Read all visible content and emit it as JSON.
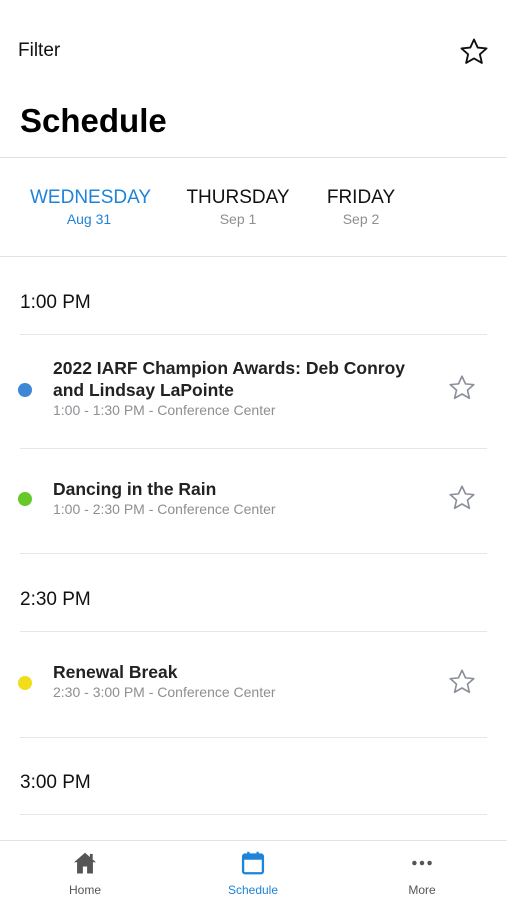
{
  "header": {
    "filter_label": "Filter",
    "favorites_icon": "star-outline-icon",
    "title": "Schedule"
  },
  "days": [
    {
      "name": "WEDNESDAY",
      "date": "Aug 31",
      "active": true
    },
    {
      "name": "THURSDAY",
      "date": "Sep 1",
      "active": false
    },
    {
      "name": "FRIDAY",
      "date": "Sep 2",
      "active": false
    }
  ],
  "schedule": {
    "groups": [
      {
        "time": "1:00 PM",
        "sessions": [
          {
            "title": "2022 IARF Champion Awards: Deb Conroy and Lindsay LaPointe",
            "meta": "1:00 - 1:30 PM - Conference Center",
            "color": "#3d87d6"
          },
          {
            "title": "Dancing in the Rain",
            "meta": "1:00 - 2:30 PM - Conference Center",
            "color": "#66c92a"
          }
        ]
      },
      {
        "time": "2:30 PM",
        "sessions": [
          {
            "title": "Renewal Break",
            "meta": "2:30 - 3:00 PM - Conference Center",
            "color": "#f2dd1b"
          }
        ]
      },
      {
        "time": "3:00 PM",
        "sessions": []
      }
    ]
  },
  "bottom_nav": {
    "items": [
      {
        "label": "Home",
        "icon": "home-icon",
        "active": false
      },
      {
        "label": "Schedule",
        "icon": "calendar-icon",
        "active": true
      },
      {
        "label": "More",
        "icon": "more-dots-icon",
        "active": false
      }
    ]
  },
  "colors": {
    "accent": "#1f83d9",
    "muted_text": "#8e8e93"
  }
}
